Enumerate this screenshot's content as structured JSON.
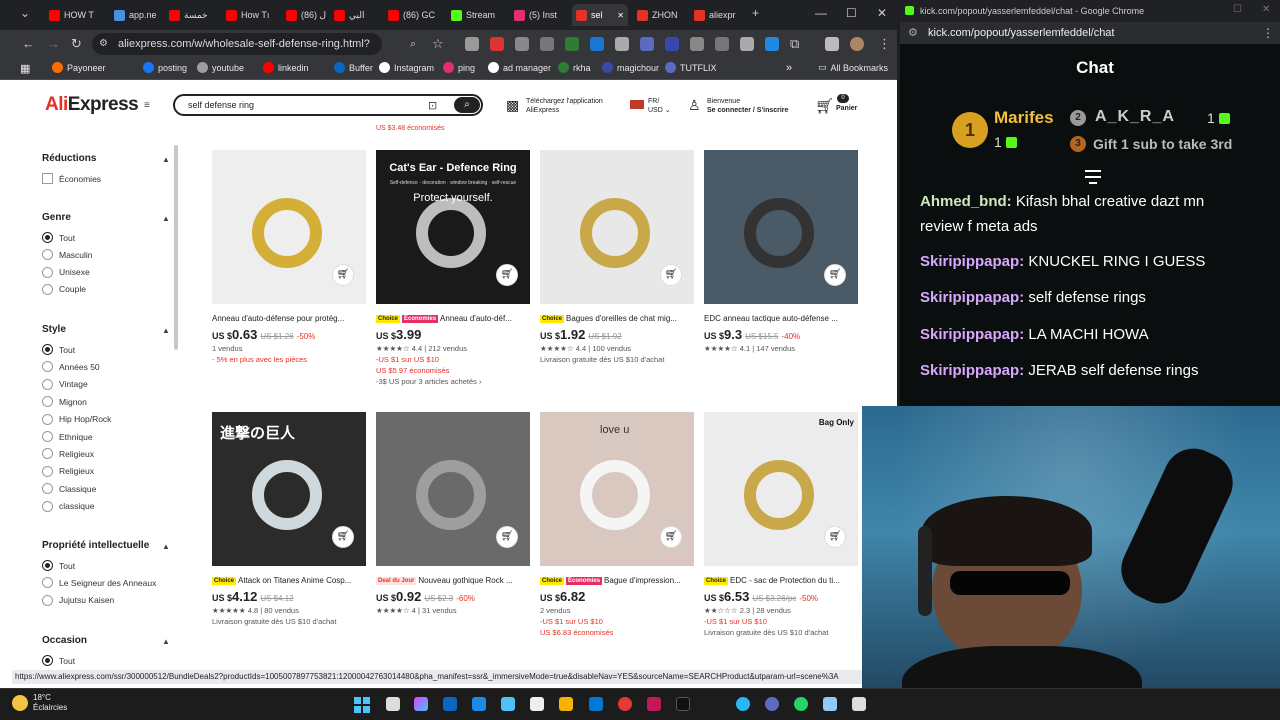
{
  "browser_left": {
    "tabs": [
      {
        "label": "HOW T",
        "color": "#ff0000"
      },
      {
        "label": "app.ne",
        "color": "#4a90e2"
      },
      {
        "label": "خمسة",
        "color": "#ff0000"
      },
      {
        "label": "How Tı",
        "color": "#ff0000"
      },
      {
        "label": "ال (86)",
        "color": "#ff0000"
      },
      {
        "label": "البي",
        "color": "#ff0000"
      },
      {
        "label": "(86) GC",
        "color": "#ff0000"
      },
      {
        "label": "Stream",
        "color": "#53fc18"
      },
      {
        "label": "(5) Inst",
        "color": "#e1306c"
      },
      {
        "label": "sel",
        "color": "#e43225"
      },
      {
        "label": "ZHON",
        "color": "#e43225"
      },
      {
        "label": "aliexpr",
        "color": "#e43225"
      }
    ],
    "url": "aliexpress.com/w/wholesale-self-defense-ring.html?spm=...",
    "bookmarks": [
      "Payoneer",
      "posting",
      "youtube",
      "linkedin",
      "Buffer",
      "Instagram",
      "ping",
      "ad manager",
      "rkha",
      "magichour",
      "TUTFLIX"
    ],
    "bookmarks_folder": "All Bookmarks",
    "status_url": "https://www.aliexpress.com/ssr/300000512/BundleDeals2?productIds=1005007897753821:12000042763014480&pha_manifest=ssr&_immersiveMode=true&disableNav=YES&sourceName=SEARCHProduct&utparam-url=scene%3A"
  },
  "aliexpress": {
    "logo_main": "Ali",
    "logo_rest": "Express",
    "search_value": "self defense ring",
    "app_line1": "Téléchargez l'application",
    "app_line2": "AliExpress",
    "locale_line1": "FR/",
    "locale_line2": "USD",
    "account_line1": "Bienvenue",
    "account_line2": "Se connecter / S'inscrire",
    "cart_count": "0",
    "cart_label": "Panier",
    "top_cut_text": "US $3.48 économisés"
  },
  "filters": {
    "reductions": {
      "title": "Réductions",
      "options": [
        "Économies"
      ]
    },
    "genre": {
      "title": "Genre",
      "options": [
        "Tout",
        "Masculin",
        "Unisexe",
        "Couple"
      ]
    },
    "style": {
      "title": "Style",
      "options": [
        "Tout",
        "Années 50",
        "Vintage",
        "Mignon",
        "Hip Hop/Rock",
        "Ethnique",
        "Religieux",
        "Religieux",
        "Classique",
        "classique"
      ]
    },
    "ip": {
      "title": "Propriété intellectuelle",
      "options": [
        "Tout",
        "Le Seigneur des Anneaux",
        "Jujutsu Kaisen"
      ]
    },
    "occasion": {
      "title": "Occasion",
      "options": [
        "Tout"
      ]
    }
  },
  "products": [
    {
      "title": "Anneau d'auto-défense pour protég...",
      "badges": [],
      "price_int": "0",
      "price_dec": ".63",
      "old": "US $1.26",
      "disc": "-50%",
      "line1": "1 vendus",
      "line2": "- 5% en plus avec les pièces",
      "line3": "",
      "line4": ""
    },
    {
      "title": "Anneau d'auto-déf...",
      "badges": [
        "Choice",
        "Économies"
      ],
      "price_int": "3",
      "price_dec": ".99",
      "old": "",
      "disc": "",
      "line1": "★★★★☆ 4.4 | 212 vendus",
      "line2": "-US $1 sur US $10",
      "line3": "US $5.97 économisés",
      "line4": "-3$ US pour 3 articles achetés ›",
      "image_heading": "Cat's Ear - Defence Ring",
      "image_tags": "Self-defence · decoration · window breaking · self-rescue",
      "image_sub": "Protect yourself."
    },
    {
      "title": "Bagues d'oreilles de chat mig...",
      "badges": [
        "Choice"
      ],
      "price_int": "1",
      "price_dec": ".92",
      "old": "US $1.92",
      "disc": "",
      "line1": "★★★★☆ 4.4 | 100 vendus",
      "line2": "Livraison gratuite dès US $10 d'achat",
      "line3": "",
      "line4": ""
    },
    {
      "title": "EDC anneau tactique auto-défense ...",
      "badges": [],
      "price_int": "9",
      "price_dec": ".3",
      "old": "US $15.5",
      "disc": "-40%",
      "line1": "★★★★☆ 4.1 | 147 vendus",
      "line2": "",
      "line3": "",
      "line4": ""
    },
    {
      "title": "Attack on Titanes Anime Cosp...",
      "badges": [
        "Choice"
      ],
      "price_int": "4",
      "price_dec": ".12",
      "old": "US $4.12",
      "disc": "",
      "line1": "★★★★★ 4.8 | 80 vendus",
      "line2": "Livraison gratuite dès US $10 d'achat",
      "line3": "",
      "line4": "",
      "image_heading": "進撃の巨人"
    },
    {
      "title": "Nouveau gothique Rock ...",
      "badges": [
        "Deal du Jour"
      ],
      "price_int": "0",
      "price_dec": ".92",
      "old": "US $2.3",
      "disc": "-60%",
      "line1": "★★★★☆ 4 | 31 vendus",
      "line2": "",
      "line3": "",
      "line4": ""
    },
    {
      "title": "Bague d'impression...",
      "badges": [
        "Choice",
        "Économies"
      ],
      "price_int": "6",
      "price_dec": ".82",
      "old": "",
      "disc": "",
      "line1": "2 vendus",
      "line2": "-US $1 sur US $10",
      "line3": "US $6.83 économisés",
      "line4": "",
      "image_heading": "love u"
    },
    {
      "title": "EDC - sac de Protection du ti...",
      "badges": [
        "Choice"
      ],
      "price_int": "6",
      "price_dec": ".53",
      "old": "US $3.26/pc",
      "disc": "-50%",
      "line1": "★★☆☆☆ 2.3 | 28 vendus",
      "line2": "-US $1 sur US $10",
      "line3": "Livraison gratuite dès US $10 d'achat",
      "line4": "",
      "image_heading": "Bag Only"
    }
  ],
  "price_prefix": "US $",
  "popout": {
    "window_title": "kick.com/popout/yasserlemfeddel/chat - Google Chrome",
    "url": "kick.com/popout/yasserlemfeddel/chat",
    "chat_title": "Chat",
    "leaderboard": [
      {
        "rank": "1",
        "name": "Marifes",
        "subs": "1"
      },
      {
        "rank": "2",
        "name": "A_K_R_A",
        "subs": "1"
      },
      {
        "rank": "3",
        "name": "Gift 1 sub to take 3rd",
        "subs": ""
      }
    ],
    "messages": [
      {
        "user": "Ahmed_bnd",
        "text": "Kifash bhal creative dazt mn review f meta ads"
      },
      {
        "user": "Skiripippapap",
        "text": "KNUCKEL RING I GUESS"
      },
      {
        "user": "Skiripippapap",
        "text": "self defense rings"
      },
      {
        "user": "Skiripippapap",
        "text": "LA MACHI HOWA"
      },
      {
        "user": "Skiripippapap",
        "text": "JERAB self defense rings"
      }
    ]
  },
  "taskbar": {
    "temperature": "18°C",
    "weather": "Éclaircies"
  },
  "colors": {
    "ali_red": "#e43225",
    "kick_green": "#53fc18",
    "chat_bg": "#0b0e0f"
  }
}
